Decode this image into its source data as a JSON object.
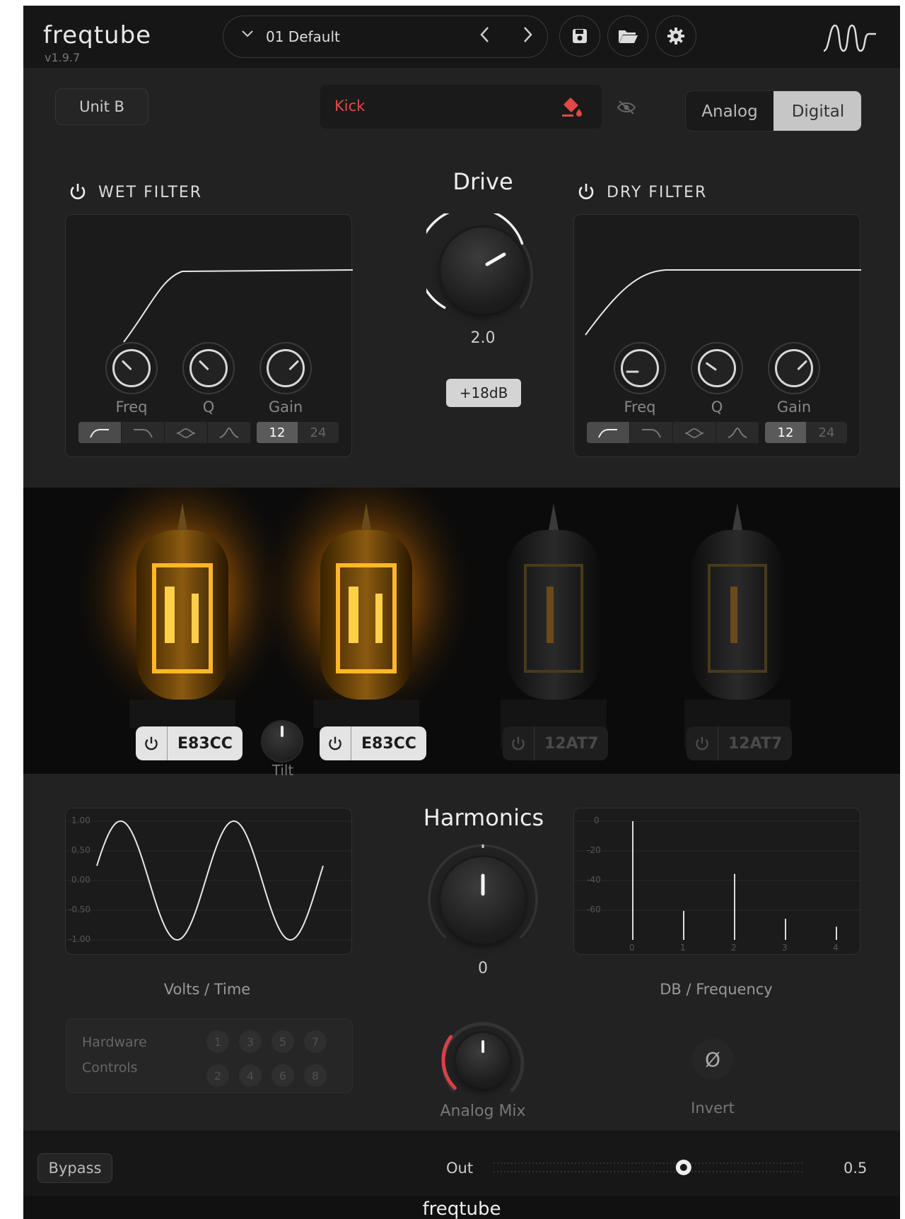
{
  "app": {
    "name": "freqtube",
    "version": "v1.9.7"
  },
  "preset": {
    "name": "01 Default"
  },
  "icons": {
    "chevron": "chevron-down-icon",
    "prev": "chevron-left-icon",
    "next": "chevron-right-icon",
    "save": "save-icon",
    "open": "folder-open-icon",
    "settings": "gear-icon",
    "brand": "waveform-logo-icon",
    "paint": "paint-bucket-icon",
    "hide": "eye-off-icon",
    "power": "power-icon",
    "invert": "phase-invert-icon"
  },
  "unit": {
    "label": "Unit B"
  },
  "track": {
    "name": "Kick",
    "color": "#e24848"
  },
  "mode": {
    "analog": "Analog",
    "digital": "Digital",
    "selected": "Digital"
  },
  "wet_filter": {
    "title": "WET FILTER",
    "freq": "Freq",
    "q": "Q",
    "gain": "Gain",
    "slopes": [
      "12",
      "24"
    ],
    "selected_slope": "12",
    "selected_type": "highpass"
  },
  "dry_filter": {
    "title": "DRY FILTER",
    "freq": "Freq",
    "q": "Q",
    "gain": "Gain",
    "slopes": [
      "12",
      "24"
    ],
    "selected_slope": "12",
    "selected_type": "highpass"
  },
  "drive": {
    "title": "Drive",
    "value": "2.0",
    "boost": "+18dB"
  },
  "tubes": [
    {
      "name": "E83CC",
      "enabled": true
    },
    {
      "name": "E83CC",
      "enabled": true
    },
    {
      "name": "12AT7",
      "enabled": false
    },
    {
      "name": "12AT7",
      "enabled": false
    }
  ],
  "tilt": {
    "label": "Tilt"
  },
  "scope": {
    "label": "Volts / Time",
    "ticks": [
      "1.00",
      "0.50",
      "0.00",
      "-0.50",
      "-1.00"
    ]
  },
  "harmonics": {
    "title": "Harmonics",
    "value": "0"
  },
  "spectrum": {
    "label": "DB / Frequency",
    "yticks": [
      "0",
      "-20",
      "-40",
      "-60"
    ],
    "xticks": [
      "0",
      "1",
      "2",
      "3",
      "4"
    ],
    "bars_db": [
      0,
      -68,
      -40,
      -74,
      -80
    ]
  },
  "hardware": {
    "line1": "Hardware",
    "line2": "Controls",
    "top": [
      "1",
      "3",
      "5",
      "7"
    ],
    "bottom": [
      "2",
      "4",
      "6",
      "8"
    ]
  },
  "analog_mix": {
    "label": "Analog Mix",
    "level": 0.3,
    "accent": "#d9404a"
  },
  "invert": {
    "label": "Invert",
    "symbol": "Ø"
  },
  "bypass": {
    "label": "Bypass"
  },
  "output": {
    "label": "Out",
    "value": "0.5"
  },
  "footer": {
    "title": "freqtube"
  }
}
